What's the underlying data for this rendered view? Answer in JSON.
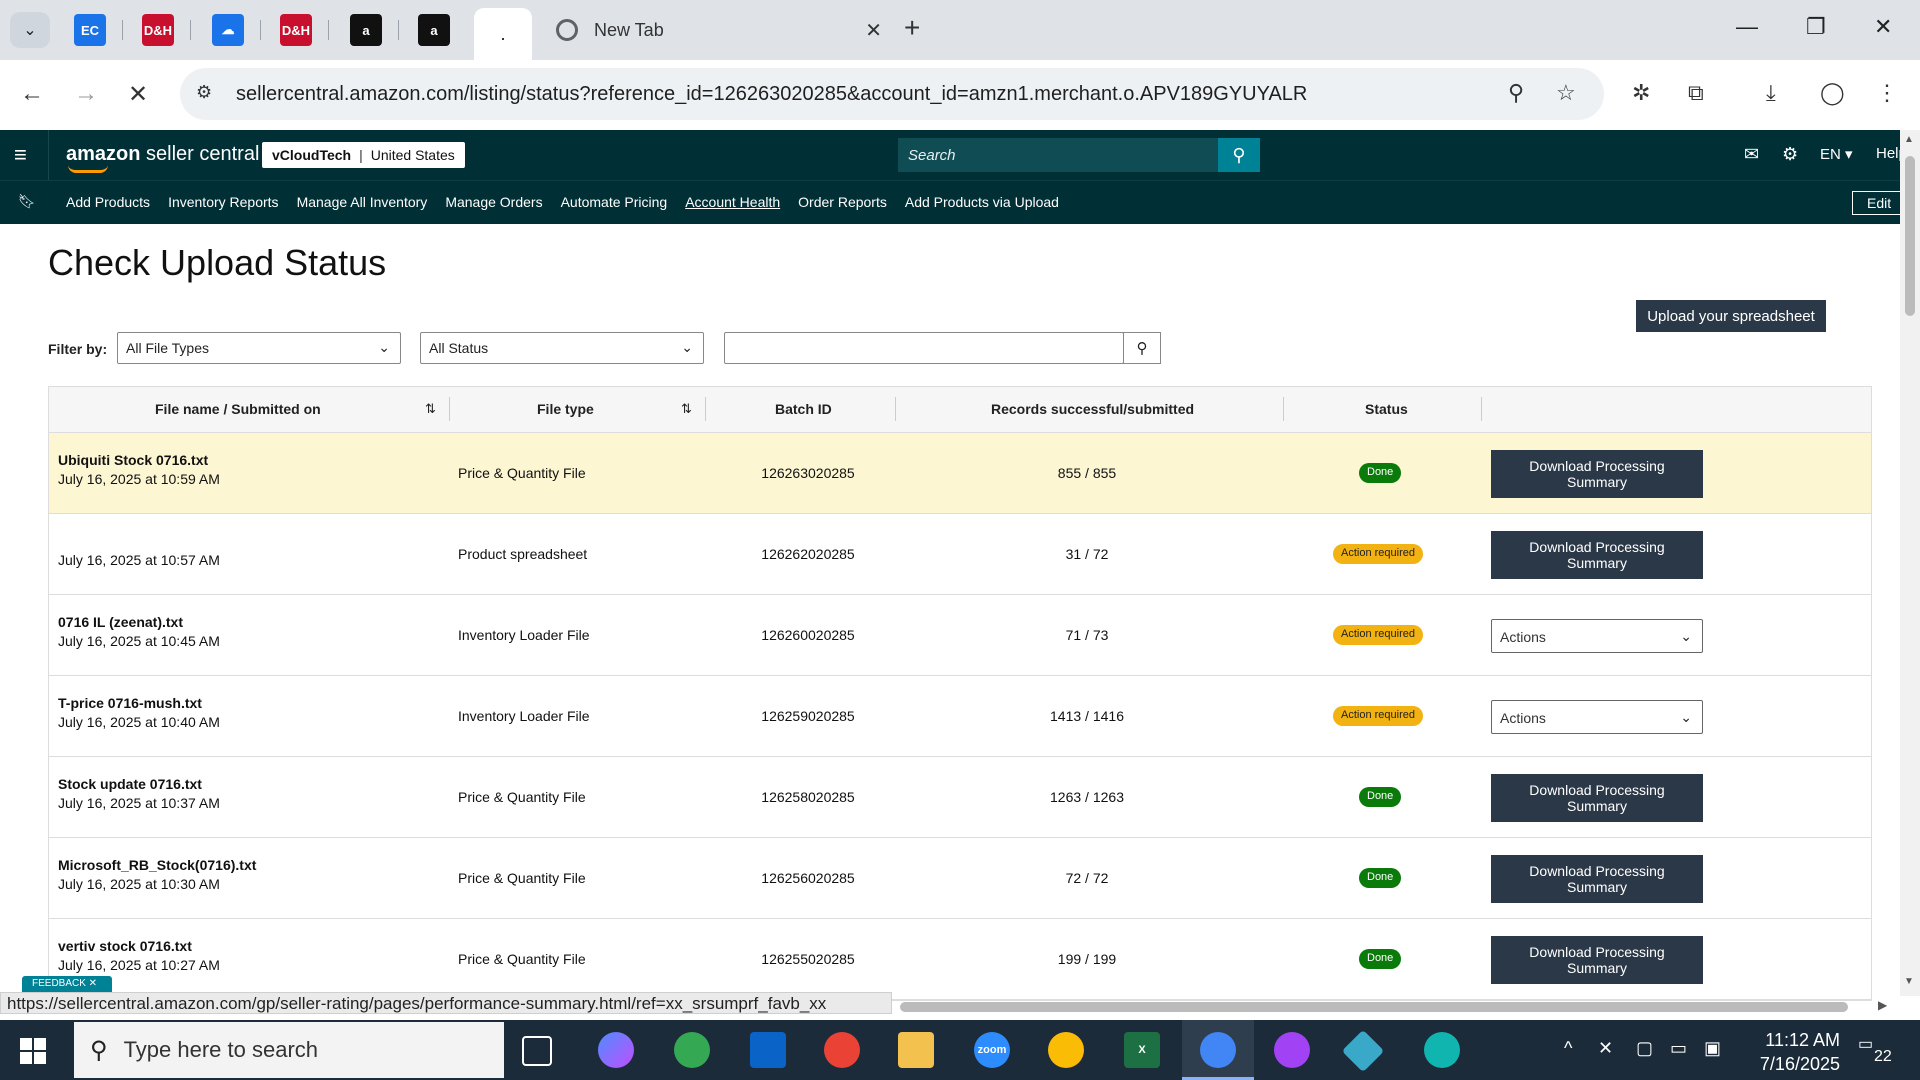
{
  "browser": {
    "tab_title": "New Tab",
    "active_tab_label": ".",
    "pinned_tabs": [
      {
        "icon": "ec-icon",
        "glyph": "EC",
        "color": "#1a73e8"
      },
      {
        "icon": "dh-icon",
        "glyph": "D&H",
        "color": "#c8102e"
      },
      {
        "icon": "cloud-icon",
        "glyph": "☁",
        "color": "#1a73e8"
      },
      {
        "icon": "dh-icon",
        "glyph": "D&H",
        "color": "#c8102e"
      },
      {
        "icon": "amazon-icon",
        "glyph": "a",
        "color": "#111111"
      },
      {
        "icon": "amazon-icon",
        "glyph": "a",
        "color": "#111111"
      }
    ],
    "url": "sellercentral.amazon.com/listing/status?reference_id=126263020285&account_id=amzn1.merchant.o.APV189GYUYALR",
    "status_url": "https://sellercentral.amazon.com/gp/seller-rating/pages/performance-summary.html/ref=xx_srsumprf_favb_xx"
  },
  "header": {
    "logo_amazon": "amazon",
    "logo_rest": "seller central",
    "account_name": "vCloudTech",
    "account_country": "United States",
    "search_placeholder": "Search",
    "language": "EN ▾",
    "help": "Help"
  },
  "nav": {
    "links": [
      {
        "label": "Add Products",
        "underline": false
      },
      {
        "label": "Inventory Reports",
        "underline": false
      },
      {
        "label": "Manage All Inventory",
        "underline": false
      },
      {
        "label": "Manage Orders",
        "underline": false
      },
      {
        "label": "Automate Pricing",
        "underline": false
      },
      {
        "label": "Account Health",
        "underline": true
      },
      {
        "label": "Order Reports",
        "underline": false
      },
      {
        "label": "Add Products via Upload",
        "underline": false
      }
    ],
    "edit": "Edit"
  },
  "page": {
    "title": "Check Upload Status",
    "upload_button": "Upload your spreadsheet",
    "filter_label": "Filter by:",
    "file_type_select": "All File Types",
    "status_select": "All Status",
    "search_value": ""
  },
  "table": {
    "headers": {
      "file_name": "File name / Submitted on",
      "file_type": "File type",
      "batch_id": "Batch ID",
      "records": "Records successful/submitted",
      "status": "Status"
    },
    "rows": [
      {
        "name": "Ubiquiti Stock 0716.txt",
        "date": "July 16, 2025 at 10:59 AM",
        "type": "Price & Quantity File",
        "batch": "126263020285",
        "records": "855 / 855",
        "status": "Done",
        "action": "Download Processing Summary",
        "highlight": true
      },
      {
        "name": "",
        "date": "July 16, 2025 at 10:57 AM",
        "type": "Product spreadsheet",
        "batch": "126262020285",
        "records": "31 / 72",
        "status": "Action required",
        "action": "Download Processing Summary",
        "highlight": false
      },
      {
        "name": "0716 IL (zeenat).txt",
        "date": "July 16, 2025 at 10:45 AM",
        "type": "Inventory Loader File",
        "batch": "126260020285",
        "records": "71 / 73",
        "status": "Action required",
        "action": "Actions",
        "highlight": false
      },
      {
        "name": "T-price 0716-mush.txt",
        "date": "July 16, 2025 at 10:40 AM",
        "type": "Inventory Loader File",
        "batch": "126259020285",
        "records": "1413 / 1416",
        "status": "Action required",
        "action": "Actions",
        "highlight": false
      },
      {
        "name": "Stock update 0716.txt",
        "date": "July 16, 2025 at 10:37 AM",
        "type": "Price & Quantity File",
        "batch": "126258020285",
        "records": "1263 / 1263",
        "status": "Done",
        "action": "Download Processing Summary",
        "highlight": false
      },
      {
        "name": "Microsoft_RB_Stock(0716).txt",
        "date": "July 16, 2025 at 10:30 AM",
        "type": "Price & Quantity File",
        "batch": "126256020285",
        "records": "72 / 72",
        "status": "Done",
        "action": "Download Processing Summary",
        "highlight": false
      },
      {
        "name": "vertiv stock 0716.txt",
        "date": "July 16, 2025 at 10:27 AM",
        "type": "Price & Quantity File",
        "batch": "126255020285",
        "records": "199 / 199",
        "status": "Done",
        "action": "Download Processing Summary",
        "highlight": false
      }
    ]
  },
  "feedback": "FEEDBACK ✕",
  "taskbar": {
    "search_placeholder": "Type here to search",
    "time": "11:12 AM",
    "date": "7/16/2025",
    "notifications": "22"
  },
  "colors": {
    "header_bg": "#002f36",
    "button_dark": "#2b3847",
    "done": "#0a7a0a",
    "action_required": "#f2b211",
    "highlight_row": "#fdf6d3"
  }
}
